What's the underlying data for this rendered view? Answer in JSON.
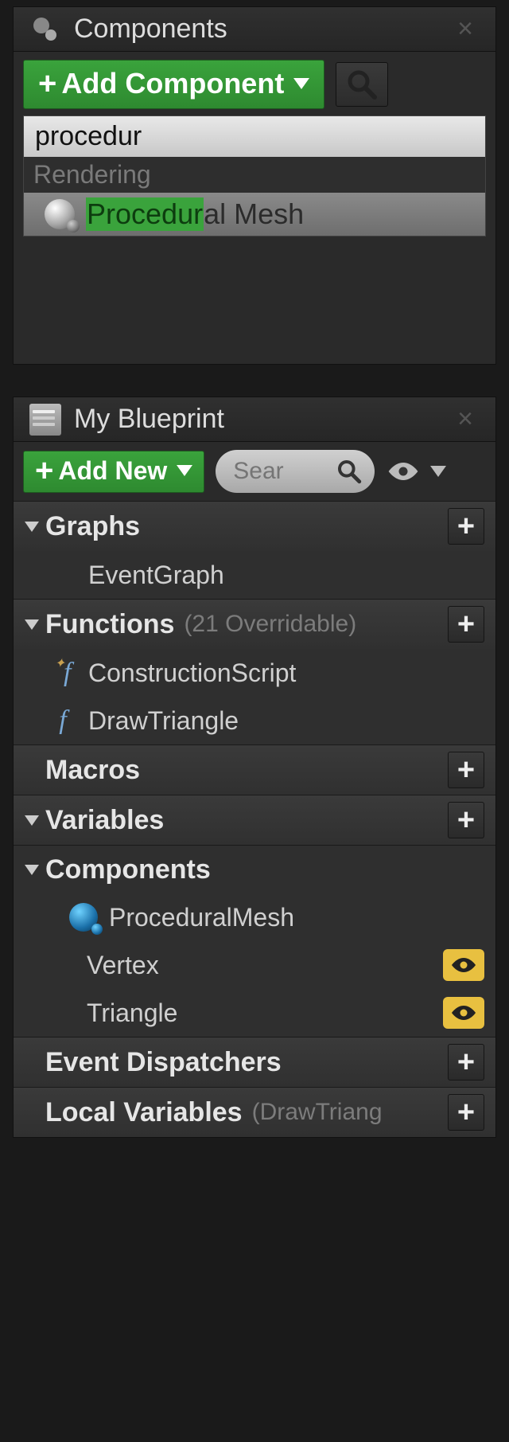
{
  "components_panel": {
    "title": "Components",
    "add_button": "Add Component",
    "search_value": "procedur",
    "dropdown": {
      "category": "Rendering",
      "result": {
        "match": "Procedur",
        "rest": "al Mesh"
      }
    }
  },
  "blueprint_panel": {
    "title": "My Blueprint",
    "add_button": "Add New",
    "search_placeholder": "Sear",
    "sections": {
      "graphs": {
        "label": "Graphs",
        "items": [
          {
            "name": "EventGraph",
            "kind": "eventgraph"
          }
        ]
      },
      "functions": {
        "label": "Functions",
        "sub": "(21 Overridable)",
        "items": [
          {
            "name": "ConstructionScript",
            "kind": "fn-star"
          },
          {
            "name": "DrawTriangle",
            "kind": "fn"
          }
        ]
      },
      "macros": {
        "label": "Macros"
      },
      "variables": {
        "label": "Variables"
      },
      "components": {
        "label": "Components",
        "items": [
          {
            "name": "ProceduralMesh",
            "kind": "sphere"
          },
          {
            "name": "Vertex",
            "kind": "array-yellow",
            "eye": true
          },
          {
            "name": "Triangle",
            "kind": "array-cyan",
            "eye": true
          }
        ]
      },
      "dispatchers": {
        "label": "Event Dispatchers"
      },
      "localvars": {
        "label": "Local Variables",
        "sub": "(DrawTriang"
      }
    }
  }
}
